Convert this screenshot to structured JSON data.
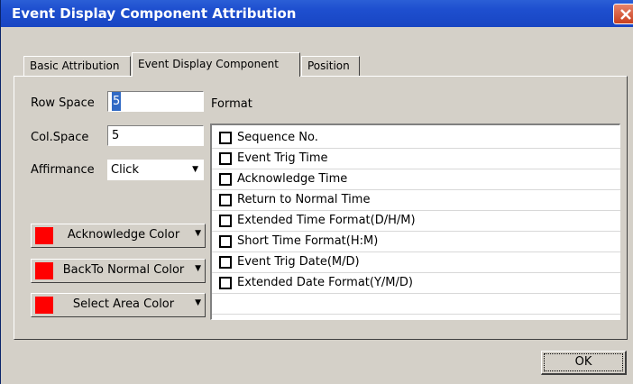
{
  "window": {
    "title": "Event Display Component Attribution"
  },
  "tabs": [
    {
      "label": "Basic Attribution",
      "active": false
    },
    {
      "label": "Event Display Component",
      "active": true
    },
    {
      "label": "Position",
      "active": false
    }
  ],
  "form": {
    "row_space": {
      "label": "Row Space",
      "value": "5"
    },
    "col_space": {
      "label": "Col.Space",
      "value": "5"
    },
    "affirmance": {
      "label": "Affirmance",
      "value": "Click"
    }
  },
  "color_buttons": [
    {
      "label": "Acknowledge Color",
      "color": "#ff0000"
    },
    {
      "label": "BackTo Normal Color",
      "color": "#ff0000"
    },
    {
      "label": "Select Area Color",
      "color": "#ff0000"
    }
  ],
  "format": {
    "label": "Format",
    "items": [
      {
        "label": "Sequence No.",
        "checked": false
      },
      {
        "label": "Event Trig Time",
        "checked": false
      },
      {
        "label": "Acknowledge Time",
        "checked": false
      },
      {
        "label": "Return to Normal Time",
        "checked": false
      },
      {
        "label": "Extended Time Format(D/H/M)",
        "checked": false
      },
      {
        "label": "Short Time Format(H:M)",
        "checked": false
      },
      {
        "label": "Event Trig Date(M/D)",
        "checked": false
      },
      {
        "label": "Extended Date Format(Y/M/D)",
        "checked": false
      }
    ]
  },
  "footer": {
    "ok_label": "OK"
  },
  "icons": {
    "close": "close-icon",
    "dropdown": "chevron-down-icon"
  }
}
